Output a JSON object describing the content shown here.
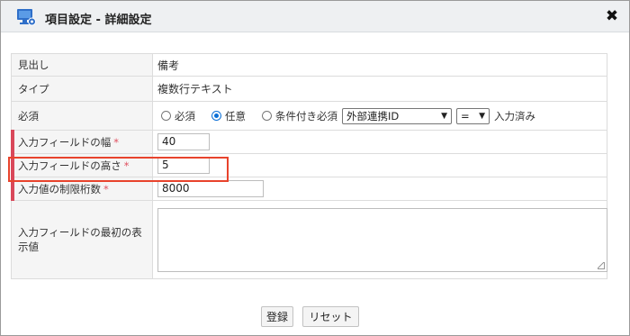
{
  "dialog": {
    "title": "項目設定 - 詳細設定",
    "close_label": "✖"
  },
  "rows": {
    "heading": {
      "label": "見出し",
      "value": "備考"
    },
    "type": {
      "label": "タイプ",
      "value": "複数行テキスト"
    },
    "required": {
      "label": "必須",
      "options": [
        "必須",
        "任意",
        "条件付き必須"
      ],
      "selected": "任意",
      "condition_field": "外部連携ID",
      "condition_operator": "=",
      "condition_value": "入力済み"
    },
    "field_width": {
      "label": "入力フィールドの幅",
      "value": "40",
      "required_mark": "*"
    },
    "field_height": {
      "label": "入力フィールドの高さ",
      "value": "5",
      "required_mark": "*"
    },
    "max_digits": {
      "label": "入力値の制限桁数",
      "value": "8000",
      "required_mark": "*"
    },
    "initial_value": {
      "label": "入力フィールドの最初の表示値",
      "value": ""
    }
  },
  "buttons": {
    "register": "登録",
    "reset": "リセット"
  },
  "colors": {
    "required_bar": "#d9485a",
    "highlight": "#e8432c",
    "radio_accent": "#0a6fd6"
  }
}
